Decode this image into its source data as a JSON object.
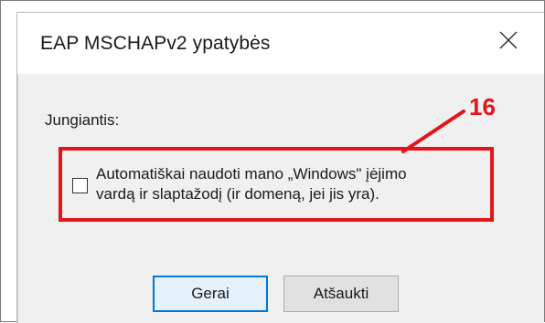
{
  "dialog": {
    "title": "EAP MSCHAPv2 ypatybės",
    "connecting_label": "Jungiantis:",
    "checkbox": {
      "label_line1": "Automatiškai naudoti mano „Windows\" įėjimo",
      "label_line2": "vardą ir slaptažodį (ir domeną, jei jis yra).",
      "checked": false
    },
    "ok_label": "Gerai",
    "cancel_label": "Atšaukti",
    "close_icon": "close-icon"
  },
  "annotation": {
    "number": "16",
    "color": "#e3151b"
  },
  "colors": {
    "accent": "#0078d7",
    "highlight": "#e3151b",
    "dialog_bg": "#f0f0f0"
  }
}
